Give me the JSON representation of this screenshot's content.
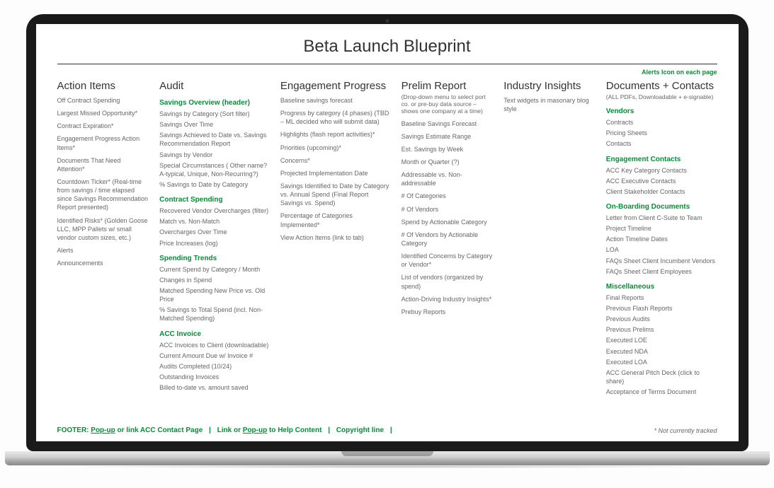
{
  "title": "Beta Launch Blueprint",
  "alerts_note": "Alerts Icon on each page",
  "columns": {
    "action_items": {
      "title": "Action Items",
      "items": [
        "Off Contract Spending",
        "Largest Missed Opportunity*",
        "Contract Expiration*",
        "Engagement Progress Action Items*",
        "Documents That Need Attention*",
        "Countdown Ticker* (Real-time from savings / time elapsed since Savings Recommendation Report presented)",
        "Identified Risks* (Golden Goose LLC, MPP Pallets w/ small vendor custom sizes, etc.)",
        "Alerts",
        "Announcements"
      ]
    },
    "audit": {
      "title": "Audit",
      "sections": [
        {
          "heading": "Savings Overview (header)",
          "items": [
            "Savings by Category (Sort filter)",
            "Savings Over Time",
            "Savings Achieved to Date vs. Savings Recommendation Report",
            "Savings by Vendor",
            "Special Circumstances ( Other name? A-typical, Unique, Non-Recurring?)",
            "% Savings to Date by Category"
          ]
        },
        {
          "heading": "Contract Spending",
          "items": [
            "Recovered Vendor Overcharges (filter)",
            "Match vs. Non-Match",
            "Overcharges Over Time",
            "Price Increases (log)"
          ]
        },
        {
          "heading": "Spending Trends",
          "items": [
            "Current Spend by Category / Month",
            "Changes in Spend",
            "Matched Spending New Price vs. Old Price",
            "% Savings to Total Spend (incl. Non-Matched Spending)"
          ]
        },
        {
          "heading": "ACC Invoice",
          "items": [
            "ACC Invoices to Client (downloadable)",
            "Current Amount Due w/ Invoice #",
            "Audits Completed (10/24)",
            "Outstanding Invoices",
            "Billed to-date vs. amount saved"
          ]
        }
      ]
    },
    "engagement": {
      "title": "Engagement Progress",
      "items": [
        "Baseline savings forecast",
        "Progress by category (4 phases) (TBD – ML decided who will submit data)",
        "Highlights (flash report activities)*",
        "Priorities (upcoming)*",
        "Concerns*",
        "Projected Implementation Date",
        "Savings Identified to Date by Category vs. Annual Spend (Final Report Savings vs. Spend)",
        "Percentage of Categories Implemented*",
        "View Action Items (link to tab)"
      ]
    },
    "prelim": {
      "title": "Prelim Report",
      "note": "(Drop-down menu to select port co. or pre-buy data source – shows one company at a time)",
      "items": [
        "Baseline Savings Forecast",
        "Savings Estimate Range",
        "Est. Savings by Week",
        "Month or Quarter (?)",
        "Addressable vs. Non-addressable",
        "# Of Categories",
        "# Of Vendors",
        "Spend by Actionable Category",
        "# Of Vendors by Actionable Category",
        "Identified Concerns by Category or Vendor*",
        "List of vendors (organized by spend)",
        "Action-Driving Industry Insights*",
        "Prebuy Reports"
      ]
    },
    "industry": {
      "title": "Industry Insights",
      "items": [
        "Text widgets in masonary blog style"
      ]
    },
    "documents": {
      "title": "Documents + Contacts",
      "note": "(ALL PDFs, Downloadable + e-signable)",
      "sections": [
        {
          "heading": "Vendors",
          "items": [
            "Contracts",
            "Pricing Sheets",
            "Contacts"
          ]
        },
        {
          "heading": "Engagement Contacts",
          "items": [
            "ACC Key Category Contacts",
            "ACC Executive Contacts",
            "Client Stakeholder Contacts"
          ]
        },
        {
          "heading": "On-Boarding Documents",
          "items": [
            "Letter from Client C-Suite to Team",
            "Project Timeline",
            "Action Timeline Dates",
            "LOA",
            "FAQs Sheet Client Incumbent Vendors",
            "FAQs Sheet Client Employees"
          ]
        },
        {
          "heading": "Miscellaneous",
          "items": [
            "Final Reports",
            "Previous Flash Reports",
            "Previous Audits",
            "Previous Prelims",
            "Executed LOE",
            "Executed NDA",
            "Executed LOA",
            "ACC General Pitch Deck (click to share)",
            "Acceptance of Terms Document"
          ]
        }
      ]
    }
  },
  "footer": {
    "prefix": "FOOTER: ",
    "p1a": "Pop-up",
    "p1b": " or link  ACC Contact Page",
    "p2a": "Link or ",
    "p2b": "Pop-up",
    "p2c": " to Help Content",
    "p3": "Copyright line",
    "right": "* Not currently tracked"
  }
}
